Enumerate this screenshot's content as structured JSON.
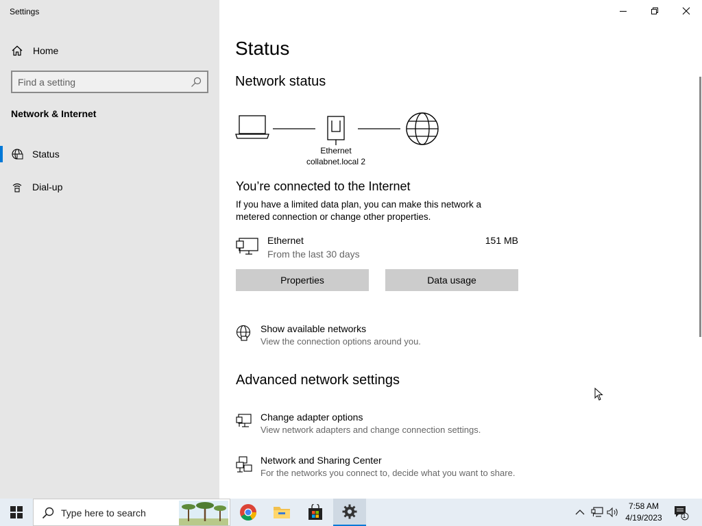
{
  "window": {
    "app_title": "Settings",
    "minimize_icon": "minimize-icon",
    "restore_icon": "restore-icon",
    "close_icon": "close-icon"
  },
  "sidebar": {
    "home_label": "Home",
    "search_placeholder": "Find a setting",
    "section_title": "Network & Internet",
    "items": [
      {
        "label": "Status",
        "icon": "globe-icon",
        "selected": true
      },
      {
        "label": "Dial-up",
        "icon": "dialup-icon",
        "selected": false
      }
    ]
  },
  "main": {
    "page_title": "Status",
    "network_status_heading": "Network status",
    "diagram": {
      "adapter_name": "Ethernet",
      "network_name": "collabnet.local 2"
    },
    "connected_heading": "You’re connected to the Internet",
    "connected_desc": "If you have a limited data plan, you can make this network a metered connection or change other properties.",
    "connection": {
      "name": "Ethernet",
      "period": "From the last 30 days",
      "usage": "151 MB"
    },
    "buttons": {
      "properties": "Properties",
      "data_usage": "Data usage"
    },
    "show_networks": {
      "title": "Show available networks",
      "subtitle": "View the connection options around you."
    },
    "advanced_heading": "Advanced network settings",
    "advanced_links": [
      {
        "title": "Change adapter options",
        "subtitle": "View network adapters and change connection settings."
      },
      {
        "title": "Network and Sharing Center",
        "subtitle": "For the networks you connect to, decide what you want to share."
      }
    ]
  },
  "taskbar": {
    "search_placeholder": "Type here to search",
    "pinned": [
      "chrome-icon",
      "file-explorer-icon",
      "store-icon",
      "settings-icon"
    ],
    "clock_time": "7:58 AM",
    "clock_date": "4/19/2023",
    "notification_count": "1"
  },
  "colors": {
    "accent": "#0078d7",
    "sidebar_bg": "#e6e6e6",
    "button_bg": "#cccccc",
    "taskbar_bg": "#e6edf4"
  }
}
